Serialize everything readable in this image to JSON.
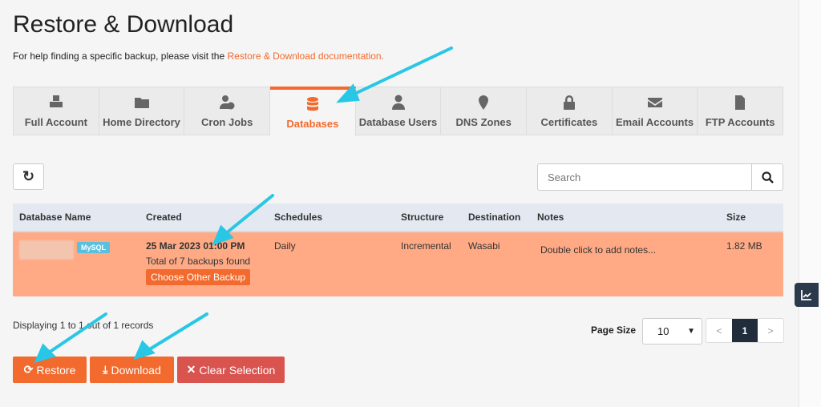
{
  "page": {
    "title": "Restore & Download",
    "help_text": "For help finding a specific backup, please visit the ",
    "help_link": "Restore & Download documentation."
  },
  "tabs": [
    {
      "label": "Full Account",
      "icon": "cubes-icon"
    },
    {
      "label": "Home Directory",
      "icon": "folder-icon"
    },
    {
      "label": "Cron Jobs",
      "icon": "user-clock-icon"
    },
    {
      "label": "Databases",
      "icon": "database-icon",
      "active": true
    },
    {
      "label": "Database Users",
      "icon": "user-tie-icon"
    },
    {
      "label": "DNS Zones",
      "icon": "map-marker-icon"
    },
    {
      "label": "Certificates",
      "icon": "lock-icon"
    },
    {
      "label": "Email Accounts",
      "icon": "envelope-icon"
    },
    {
      "label": "FTP Accounts",
      "icon": "file-icon"
    }
  ],
  "search": {
    "placeholder": "Search"
  },
  "table": {
    "headers": [
      "Database Name",
      "Created",
      "Schedules",
      "Structure",
      "Destination",
      "Notes",
      "Size"
    ],
    "rows": [
      {
        "badge": "MySQL",
        "created": "25 Mar 2023 01:00 PM",
        "backups": "Total of 7 backups found",
        "choose": "Choose Other Backup",
        "schedule": "Daily",
        "structure": "Incremental",
        "destination": "Wasabi",
        "notes": "Double click to add notes...",
        "size": "1.82 MB"
      }
    ]
  },
  "footer": {
    "displaying": "Displaying 1 to 1 out of 1 records",
    "page_size_label": "Page Size",
    "page_size": "10",
    "prev": "<",
    "page": "1",
    "next": ">"
  },
  "actions": {
    "restore": "Restore",
    "download": "Download",
    "clear": "Clear Selection"
  },
  "colors": {
    "accent": "#f26a2d",
    "row_selected": "#ffaa85",
    "danger": "#d9534f",
    "annotation": "#29c7e6"
  }
}
